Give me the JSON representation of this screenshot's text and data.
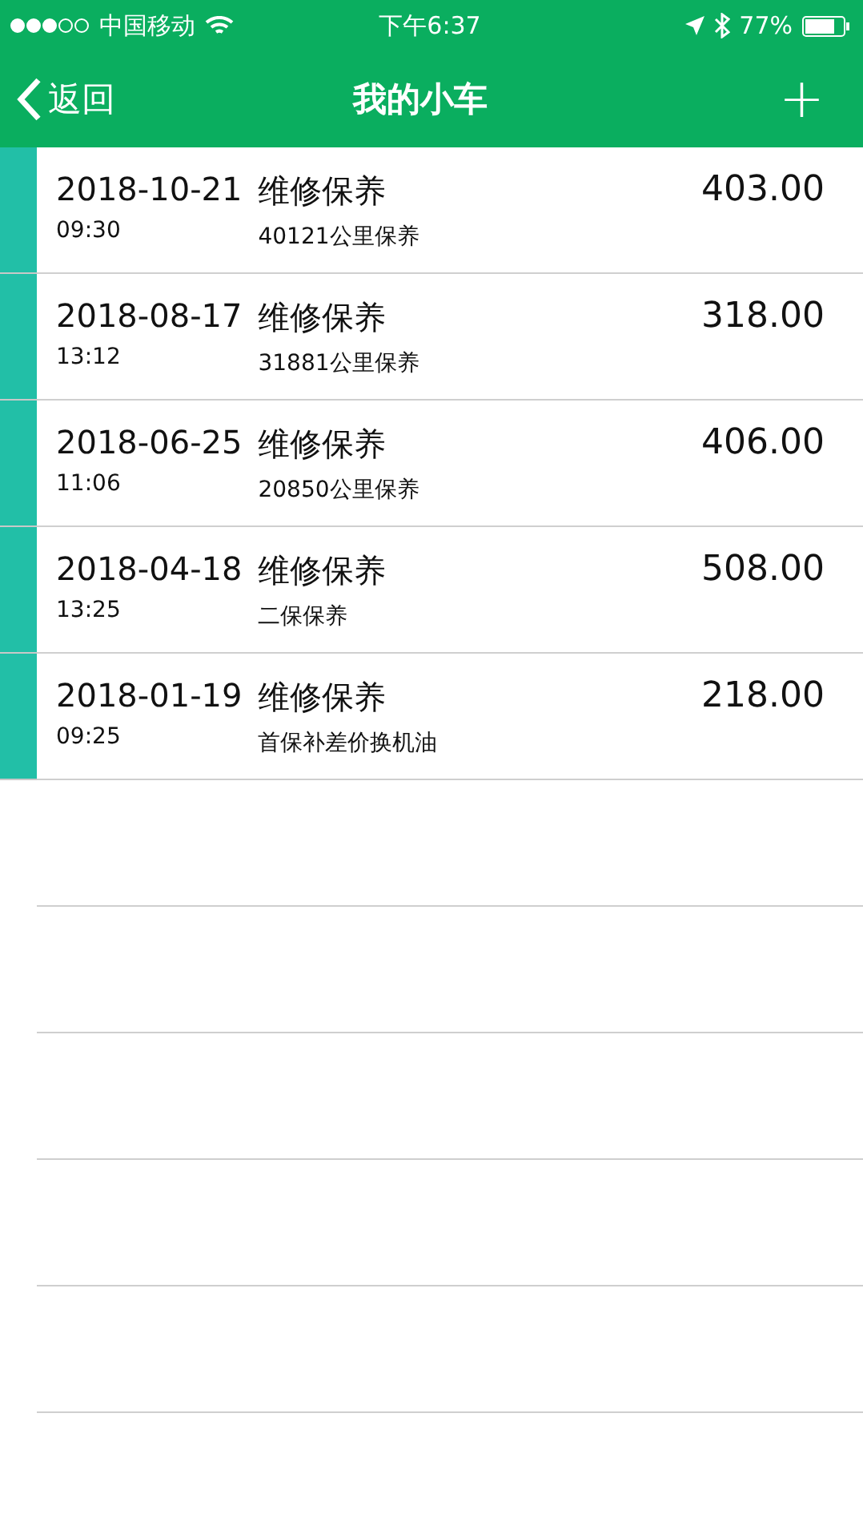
{
  "status_bar": {
    "carrier": "中国移动",
    "time": "下午6:37",
    "battery": "77%"
  },
  "nav_bar": {
    "back": "返回",
    "title": "我的小车",
    "add": "+"
  },
  "records": [
    {
      "date": "2018-10-21",
      "time": "09:30",
      "type": "维修保养",
      "note": "40121公里保养",
      "amount": "403.00"
    },
    {
      "date": "2018-08-17",
      "time": "13:12",
      "type": "维修保养",
      "note": "31881公里保养",
      "amount": "318.00"
    },
    {
      "date": "2018-06-25",
      "time": "11:06",
      "type": "维修保养",
      "note": "20850公里保养",
      "amount": "406.00"
    },
    {
      "date": "2018-04-18",
      "time": "13:25",
      "type": "维修保养",
      "note": "二保保养",
      "amount": "508.00"
    },
    {
      "date": "2018-01-19",
      "time": "09:25",
      "type": "维修保养",
      "note": "首保补差价换机油",
      "amount": "218.00"
    }
  ]
}
